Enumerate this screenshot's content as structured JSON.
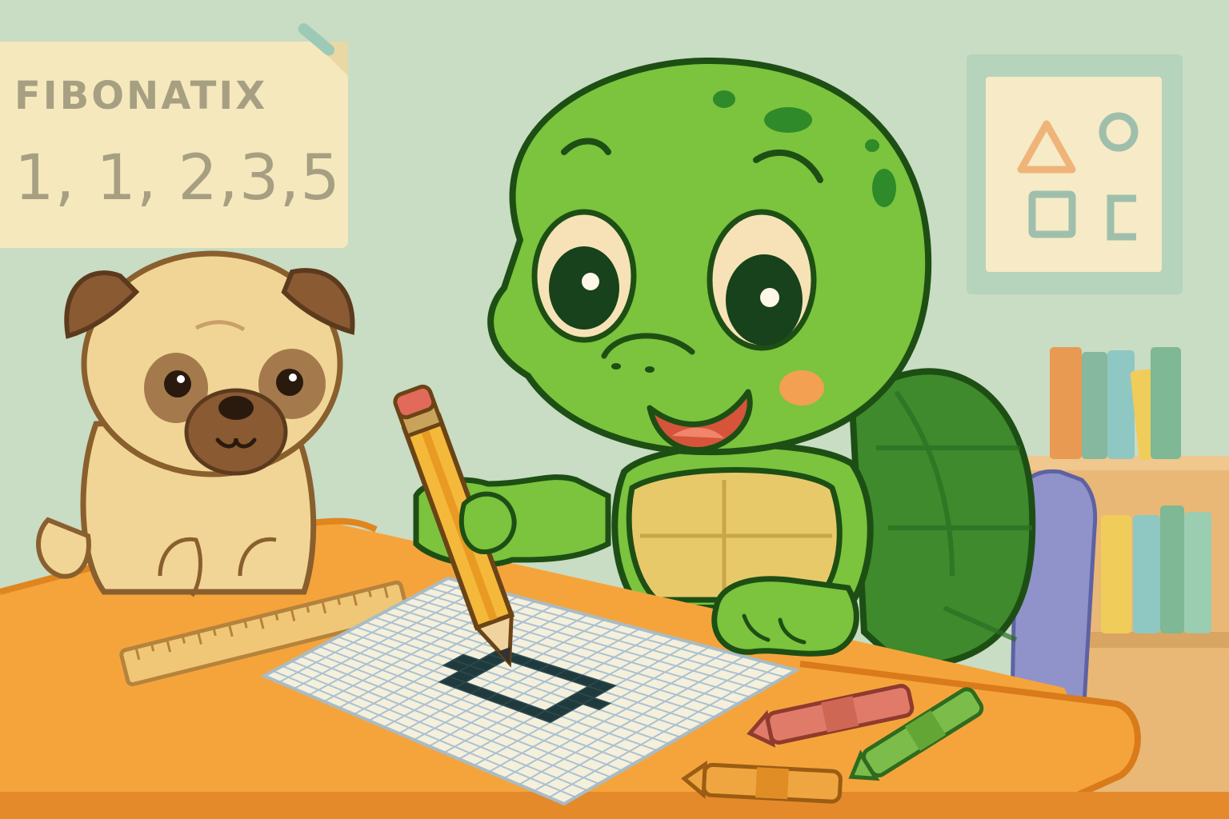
{
  "scene": {
    "subject": "turtle",
    "companion": "pug"
  },
  "poster": {
    "title": "FIBONATIX",
    "sequence": "1, 1, 2,3,5"
  },
  "shapes_poster": {
    "symbols": [
      "triangle-icon",
      "circle-icon",
      "square-icon",
      "c-shape-icon"
    ]
  },
  "colors": {
    "wall": "#c9dcc4",
    "desk": "#f5a43c",
    "turtle_skin": "#7cc33e",
    "shell": "#3e8a2c",
    "outline": "#1d4f14",
    "paper": "#f5f0dc",
    "grid_fill": "#1f3a3d"
  }
}
